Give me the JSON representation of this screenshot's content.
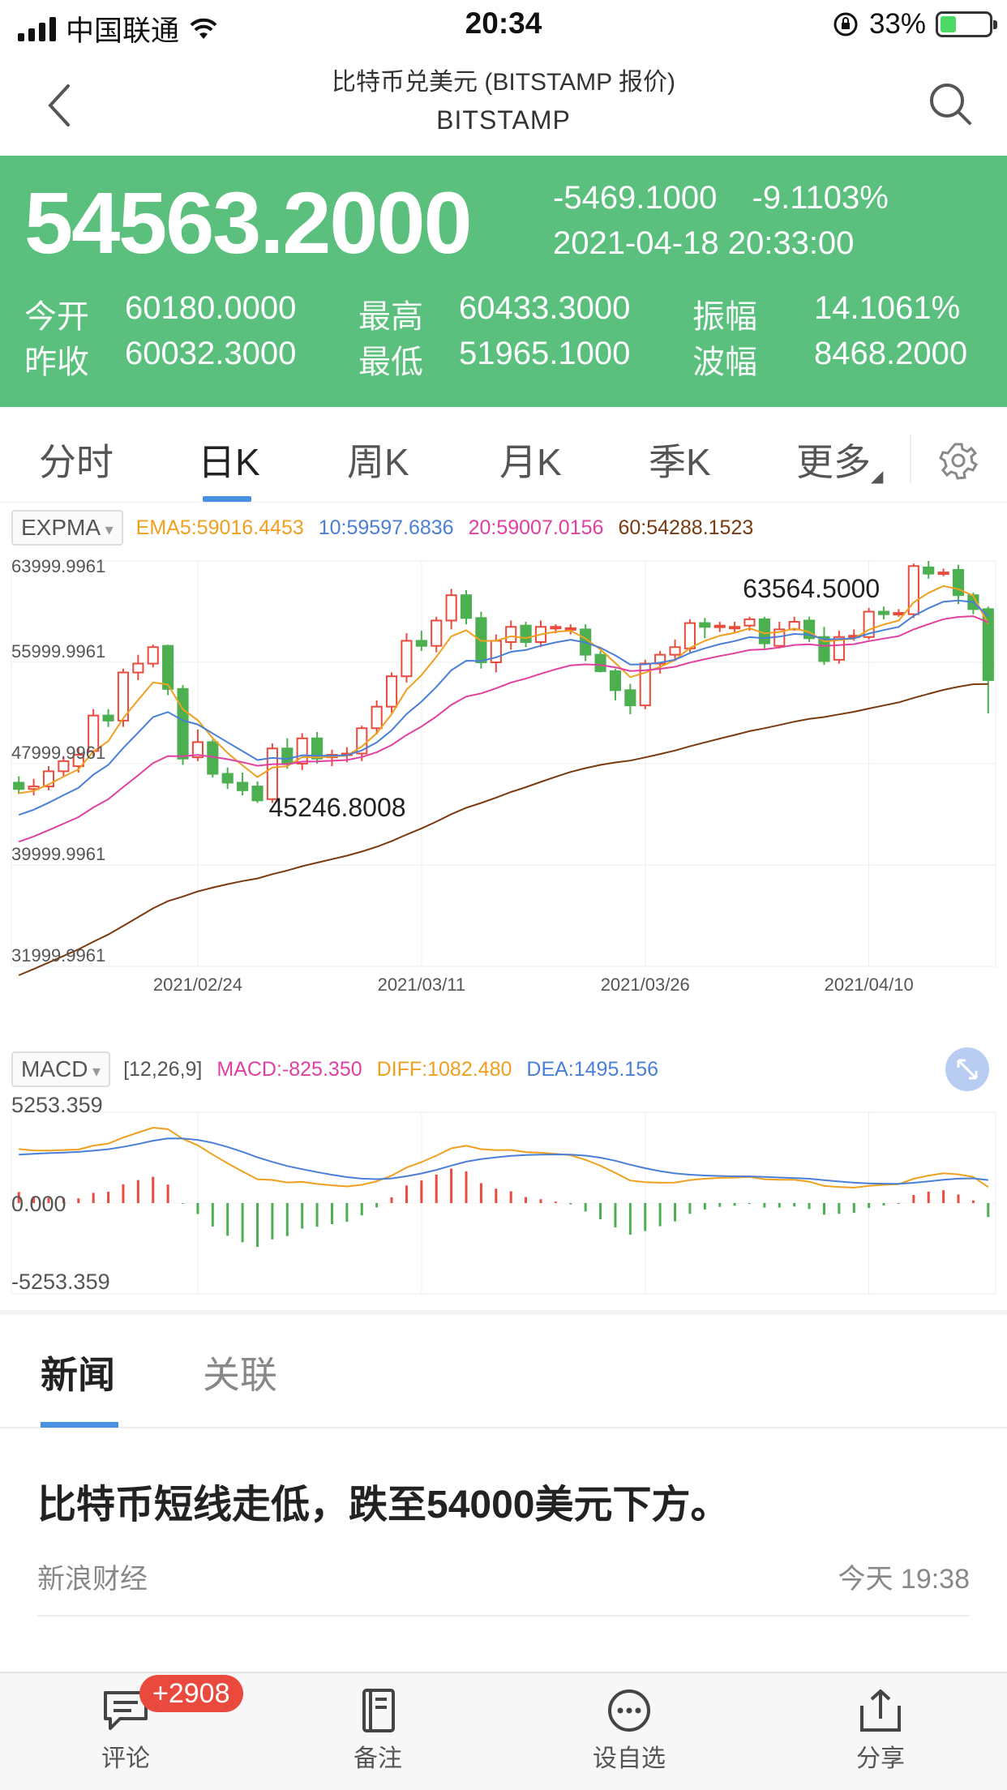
{
  "status_bar": {
    "carrier": "中国联通",
    "time": "20:34",
    "battery": "33%",
    "battery_fraction": 0.33
  },
  "header": {
    "title": "比特币兑美元 (BITSTAMP 报价)",
    "subtitle": "BITSTAMP"
  },
  "quote": {
    "price": "54563.2000",
    "change": "-5469.1000",
    "change_pct": "-9.1103%",
    "datetime": "2021-04-18 20:33:00",
    "open_label": "今开",
    "open": "60180.0000",
    "high_label": "最高",
    "high": "60433.3000",
    "amp_label": "振幅",
    "amp": "14.1061%",
    "prev_label": "昨收",
    "prev": "60032.3000",
    "low_label": "最低",
    "low": "51965.1000",
    "wave_label": "波幅",
    "wave": "8468.2000",
    "bg_color": "#5bbf7d"
  },
  "kline_tabs": [
    {
      "label": "分时",
      "active": false
    },
    {
      "label": "日K",
      "active": true
    },
    {
      "label": "周K",
      "active": false
    },
    {
      "label": "月K",
      "active": false
    },
    {
      "label": "季K",
      "active": false
    },
    {
      "label": "更多",
      "active": false
    }
  ],
  "expma_legend": {
    "selector": "EXPMA",
    "ema5": "EMA5:59016.4453",
    "ema10": "10:59597.6836",
    "ema20": "20:59007.0156",
    "ema60": "60:54288.1523"
  },
  "macd_legend": {
    "selector": "MACD",
    "params": "[12,26,9]",
    "macd": "MACD:-825.350",
    "diff": "DIFF:1082.480",
    "dea": "DEA:1495.156"
  },
  "colors": {
    "up": "#e94b3c",
    "down": "#4caf50",
    "ema5": "#f0a020",
    "ema10": "#4a7fd8",
    "ema20": "#e040a0",
    "ema60": "#7a3a10",
    "accent": "#4a90e2"
  },
  "chart_data": [
    {
      "type": "candlestick",
      "y_ticks": [
        "63999.9961",
        "55999.9961",
        "47999.9961",
        "39999.9961",
        "31999.9961"
      ],
      "ylim": [
        31999.9961,
        63999.9961
      ],
      "x_ticks": [
        {
          "label": "2021/02/24",
          "index": 12
        },
        {
          "label": "2021/03/11",
          "index": 27
        },
        {
          "label": "2021/03/26",
          "index": 42
        },
        {
          "label": "2021/04/10",
          "index": 57
        }
      ],
      "annotations": {
        "max": "63564.5000",
        "min": "45246.8008"
      },
      "candles": [
        [
          46500,
          46000,
          47000,
          45600
        ],
        [
          46000,
          46200,
          46800,
          45500
        ],
        [
          46200,
          47400,
          47800,
          45900
        ],
        [
          47400,
          48200,
          48600,
          47000
        ],
        [
          47800,
          48700,
          49300,
          47300
        ],
        [
          49000,
          51800,
          52300,
          48600
        ],
        [
          51800,
          51400,
          52300,
          50900
        ],
        [
          51400,
          55200,
          55500,
          50900
        ],
        [
          55200,
          55900,
          56600,
          54600
        ],
        [
          55900,
          57200,
          57400,
          55600
        ],
        [
          57300,
          53900,
          57400,
          53400
        ],
        [
          53900,
          48400,
          54200,
          47900
        ],
        [
          48500,
          49700,
          50700,
          48200
        ],
        [
          49700,
          47200,
          49900,
          46900
        ],
        [
          47200,
          46500,
          47700,
          46000
        ],
        [
          46500,
          45900,
          47300,
          45500
        ],
        [
          46200,
          45100,
          46600,
          44900
        ],
        [
          45200,
          49200,
          49600,
          44900
        ],
        [
          49200,
          48000,
          50000,
          47600
        ],
        [
          48000,
          50000,
          50400,
          47500
        ],
        [
          50000,
          48400,
          50500,
          48000
        ],
        [
          48500,
          48700,
          49100,
          47800
        ],
        [
          48700,
          48800,
          49300,
          48100
        ],
        [
          48800,
          50800,
          51000,
          48200
        ],
        [
          50800,
          52500,
          53000,
          50300
        ],
        [
          52500,
          54900,
          55200,
          52000
        ],
        [
          54900,
          57700,
          58300,
          54400
        ],
        [
          57700,
          57300,
          58500,
          56900
        ],
        [
          57300,
          59300,
          59600,
          56800
        ],
        [
          59300,
          61300,
          61800,
          58600
        ],
        [
          61300,
          59500,
          61700,
          59000
        ],
        [
          59500,
          56000,
          60000,
          55500
        ],
        [
          56000,
          57700,
          58200,
          55200
        ],
        [
          57600,
          58800,
          59300,
          57000
        ],
        [
          58900,
          57600,
          59200,
          57200
        ],
        [
          57600,
          58800,
          59300,
          57200
        ],
        [
          58700,
          58800,
          59000,
          58300
        ],
        [
          58600,
          58700,
          59000,
          58200
        ],
        [
          58600,
          56600,
          59000,
          56100
        ],
        [
          56600,
          55300,
          56900,
          55200
        ],
        [
          55300,
          53800,
          55500,
          53000
        ],
        [
          53800,
          52600,
          54300,
          51900
        ],
        [
          52600,
          55900,
          56200,
          52300
        ],
        [
          55900,
          56600,
          56900,
          55100
        ],
        [
          56600,
          57200,
          57800,
          56100
        ],
        [
          57100,
          59100,
          59400,
          56800
        ],
        [
          59100,
          58800,
          59500,
          57900
        ],
        [
          58900,
          58900,
          59200,
          58400
        ],
        [
          58800,
          58800,
          59200,
          58400
        ],
        [
          58900,
          59400,
          59600,
          58500
        ],
        [
          59400,
          57500,
          59600,
          57100
        ],
        [
          57300,
          58600,
          59200,
          57100
        ],
        [
          58600,
          59200,
          59600,
          58500
        ],
        [
          59300,
          57900,
          59600,
          57600
        ],
        [
          58000,
          56100,
          58800,
          55800
        ],
        [
          56200,
          58000,
          58500,
          55900
        ],
        [
          58100,
          58100,
          58600,
          57700
        ],
        [
          58000,
          60000,
          60300,
          57800
        ],
        [
          60000,
          59800,
          60400,
          59400
        ],
        [
          59800,
          59900,
          60200,
          59600
        ],
        [
          59800,
          63600,
          63800,
          59500
        ],
        [
          63500,
          63000,
          64000,
          62600
        ],
        [
          63000,
          63100,
          63400,
          62800
        ],
        [
          63300,
          61300,
          63700,
          60600
        ],
        [
          61300,
          60200,
          61500,
          59800
        ],
        [
          60200,
          54600,
          60400,
          51965
        ]
      ],
      "ema5_end": 59016.4453,
      "ema10_end": 59597.6836,
      "ema20_end": 59007.0156,
      "ema60_end": 54288.1523
    },
    {
      "type": "bar",
      "title": "MACD",
      "y_ticks": [
        "5253.359",
        "0.000",
        "-5253.359"
      ],
      "ylim": [
        -5253.359,
        5253.359
      ],
      "series": [
        {
          "name": "DIFF",
          "end": 1082.48
        },
        {
          "name": "DEA",
          "end": 1495.156
        },
        {
          "name": "MACD",
          "end": -825.35
        }
      ]
    }
  ],
  "news_tabs": [
    {
      "label": "新闻",
      "active": true
    },
    {
      "label": "关联",
      "active": false
    }
  ],
  "news": [
    {
      "headline": "比特币短线走低，跌至54000美元下方。",
      "source": "新浪财经",
      "time": "今天 19:38"
    }
  ],
  "bottom_bar": {
    "badge": "+2908",
    "items": [
      {
        "label": "评论",
        "icon": "comment-icon"
      },
      {
        "label": "备注",
        "icon": "note-icon"
      },
      {
        "label": "设自选",
        "icon": "more-dots-icon"
      },
      {
        "label": "分享",
        "icon": "share-icon"
      }
    ]
  }
}
